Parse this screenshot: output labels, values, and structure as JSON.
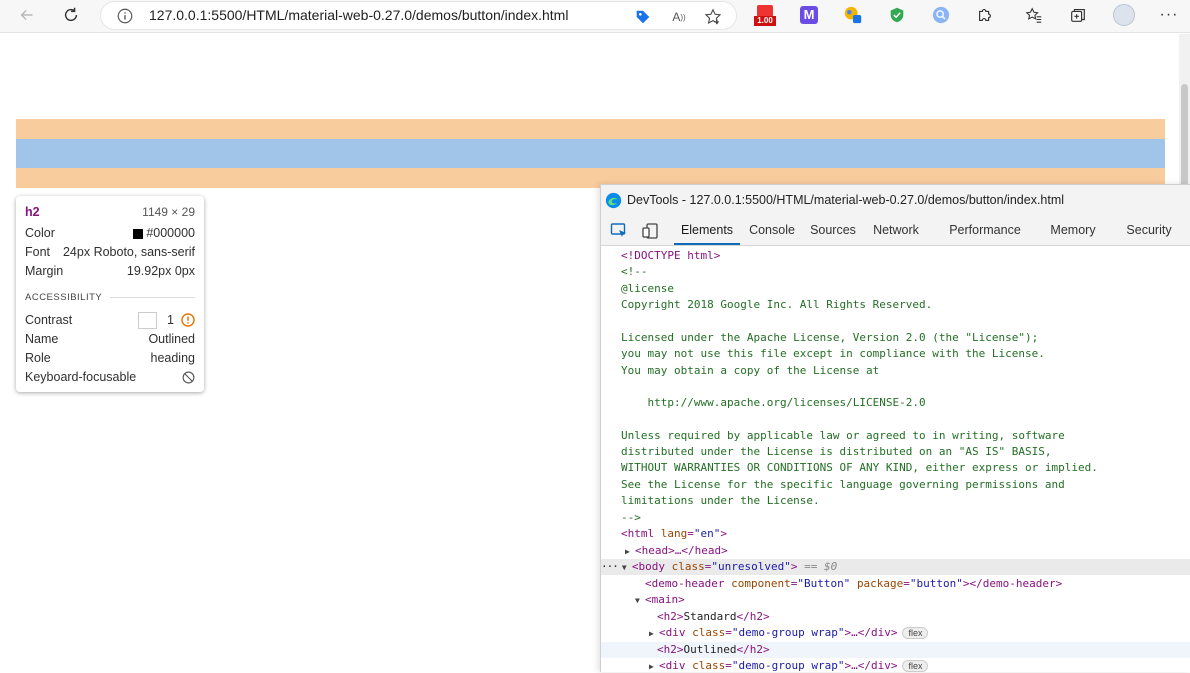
{
  "browser": {
    "url_host": "127.0.0.1",
    "url_rest": ":5500/HTML/material-web-0.27.0/demos/button/index.html",
    "ext_badge": "1.00"
  },
  "highlight": {
    "margin_color": "#f9cc9d",
    "content_color": "#a0c5e8"
  },
  "tooltip": {
    "tag": "h2",
    "size": "1149 × 29",
    "color_label": "Color",
    "color_value": "#000000",
    "font_label": "Font",
    "font_value": "24px Roboto, sans-serif",
    "margin_label": "Margin",
    "margin_value": "19.92px 0px",
    "section": "ACCESSIBILITY",
    "contrast_label": "Contrast",
    "contrast_value": "1",
    "name_label": "Name",
    "name_value": "Outlined",
    "role_label": "Role",
    "role_value": "heading",
    "keyboard_label": "Keyboard-focusable"
  },
  "devtools": {
    "title": "DevTools - 127.0.0.1:5500/HTML/material-web-0.27.0/demos/button/index.html",
    "tabs": [
      "Elements",
      "Console",
      "Sources",
      "Network",
      "Performance",
      "Memory",
      "Security"
    ],
    "active_tab": "Elements",
    "lines": {
      "doctype": "<!DOCTYPE html>",
      "c_open": "<!--",
      "c_license": "@license",
      "c_copyright": "Copyright 2018 Google Inc. All Rights Reserved.",
      "c_l1": "Licensed under the Apache License, Version 2.0 (the \"License\");",
      "c_l2": "you may not use this file except in compliance with the License.",
      "c_l3": "You may obtain a copy of the License at",
      "c_url": "    http://www.apache.org/licenses/LICENSE-2.0",
      "c_l4": "Unless required by applicable law or agreed to in writing, software",
      "c_l5": "distributed under the License is distributed on an \"AS IS\" BASIS,",
      "c_l6": "WITHOUT WARRANTIES OR CONDITIONS OF ANY KIND, either express or implied.",
      "c_l7": "See the License for the specific language governing permissions and",
      "c_l8": "limitations under the License.",
      "c_close": "-->",
      "html_tag": "<html ",
      "html_attr": "lang",
      "html_val": "\"en\"",
      "head": "<head>…</head>",
      "body_attr": "class",
      "body_val": "\"unresolved\"",
      "body_eq": "== $0",
      "demo_header_attr1": "component",
      "demo_header_val1": "\"Button\"",
      "demo_header_attr2": "package",
      "demo_header_val2": "\"button\"",
      "main": "<main>",
      "h2_standard": "Standard",
      "div_attr": "class",
      "div_val": "\"demo-group wrap\"",
      "h2_outlined": "Outlined",
      "flex_badge": "flex"
    }
  }
}
